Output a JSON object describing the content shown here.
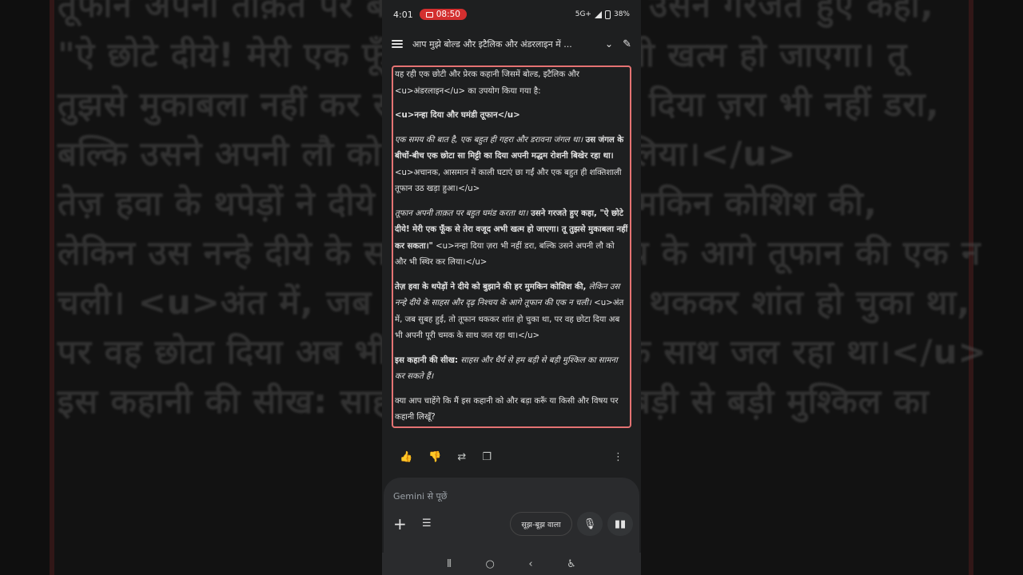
{
  "status_bar": {
    "time": "4:01",
    "recording_time": "08:50",
    "indicators": "5G+",
    "battery": "38%"
  },
  "header": {
    "title": "आप मुझे बोल्ड और इटैलिक और अंडरलाइन में ..."
  },
  "response": {
    "intro": "यह रही एक छोटी और प्रेरक कहानी जिसमें बोल्ड, इटैलिक और <u>अंडरलाइन</u> का उपयोग किया गया है:",
    "heading": "<u>नन्हा दिया और घमंडी तूफान</u>",
    "p1_italic": "एक समय की बात है, एक बहुत ही गहरा और डरावना जंगल था।",
    "p1_bold": " उस जंगल के बीचों-बीच एक छोटा सा मिट्टी का दिया अपनी मद्धम रोशनी बिखेर रहा था।",
    "p1_plain": " <u>अचानक, आसमान में काली घटाएं छा गईं और एक बहुत ही शक्तिशाली तूफान उठ खड़ा हुआ।</u>",
    "p2_italic": "तूफान अपनी ताक़त पर बहुत घमंड करता था।",
    "p2_bold": " उसने गरजते हुए कहा, \"ऐ छोटे दीये! मेरी एक फूँक से तेरा वजूद अभी खत्म हो जाएगा। तू तुझसे मुकाबला नहीं कर सकता।\"",
    "p2_plain": " <u>नन्हा दिया ज़रा भी नहीं डरा, बल्कि उसने अपनी लौ को और भी स्थिर कर लिया।</u>",
    "p3_bold": "तेज़ हवा के थपेड़ों ने दीये को बुझाने की हर मुमकिन कोशिश की,",
    "p3_italic": " लेकिन उस नन्हे दीये के साहस और दृढ़ निश्चय के आगे तूफान की एक न चली।",
    "p3_plain": " <u>अंत में, जब सुबह हुई, तो तूफान थककर शांत हो चुका था, पर वह छोटा दिया अब भी अपनी पूरी चमक के साथ जल रहा था।</u>",
    "moral_label": "इस कहानी की सीख:",
    "moral_italic": " साहस और धैर्य से हम बड़ी से बड़ी मुश्किल का सामना कर सकते हैं।",
    "closing": "क्या आप चाहेंगे कि मैं इस कहानी को और बड़ा करूँ या किसी और विषय पर कहानी लिखूँ?"
  },
  "actions": {
    "like_icon": "thumb-up-icon",
    "dislike_icon": "thumb-down-icon",
    "modify_icon": "tune-response-icon",
    "copy_icon": "copy-icon",
    "more_icon": "more-vert-icon"
  },
  "composer": {
    "placeholder": "Gemini से पूछें",
    "mode_label": "सूझ-बूझ वाला"
  },
  "background_lines": [
    "तूफान अपनी ताक़त पर बहुत घमंड करता था। उसने गरजते हुए कहा,",
    "\"ऐ छोटे दीये! मेरी एक फूँक से तेरा वजूद अभी खत्म हो जाएगा। तू",
    "तुझसे मुकाबला नहीं कर सकता।\" <u>नन्हा दिया ज़रा भी नहीं डरा,",
    "बल्कि उसने अपनी लौ को और भी स्थिर कर लिया।</u>",
    "",
    "तेज़ हवा के थपेड़ों ने दीये को बुझाने की हर मुमकिन कोशिश की,",
    "लेकिन उस नन्हे दीये के साहस और दृढ़ निश्चय के आगे तूफान की एक न",
    "चली। <u>अंत में, जब सुबह हुई, तो तूफान थककर शांत हो चुका था,",
    "पर वह छोटा दिया अब भी अपनी पूरी चमक के साथ जल रहा था।</u>",
    "",
    "इस कहानी की सीख: साहस और धैर्य से हम बड़ी से बड़ी मुश्किल का"
  ],
  "colors": {
    "highlight_border": "#e57373",
    "recording_pill": "#d32f2f"
  }
}
